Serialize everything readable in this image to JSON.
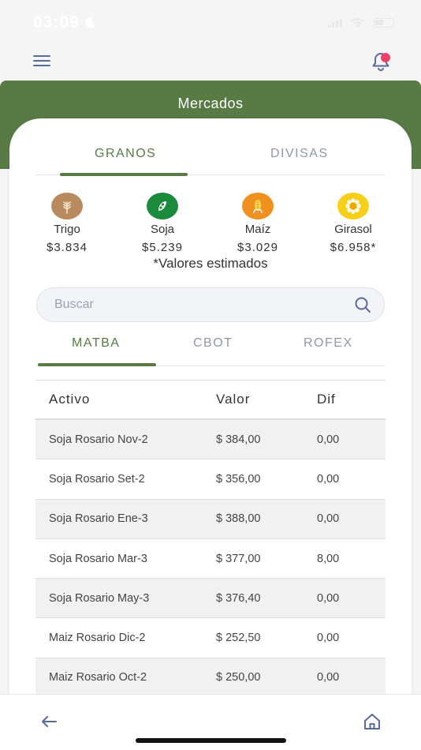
{
  "status_bar": {
    "time": "03:09"
  },
  "header": {
    "title": "Mercados"
  },
  "main_tabs": [
    {
      "label": "GRANOS",
      "active": true
    },
    {
      "label": "DIVISAS",
      "active": false
    }
  ],
  "grains": [
    {
      "name": "Trigo",
      "price": "$3.834",
      "icon": "wheat-icon",
      "color": "#b88a5e"
    },
    {
      "name": "Soja",
      "price": "$5.239",
      "icon": "soy-icon",
      "color": "#1a8a3c"
    },
    {
      "name": "Maíz",
      "price": "$3.029",
      "icon": "corn-icon",
      "color": "#f0901e"
    },
    {
      "name": "Girasol",
      "price": "$6.958*",
      "icon": "sunflower-icon",
      "color": "#f6cf18"
    }
  ],
  "estimated_note": "*Valores estimados",
  "search": {
    "placeholder": "Buscar"
  },
  "sub_tabs": [
    {
      "label": "MATBA",
      "active": true
    },
    {
      "label": "CBOT",
      "active": false
    },
    {
      "label": "ROFEX",
      "active": false
    }
  ],
  "table": {
    "headers": {
      "activo": "Activo",
      "valor": "Valor",
      "dif": "Dif"
    },
    "rows": [
      {
        "activo": "Soja Rosario Nov-2",
        "valor": "$ 384,00",
        "dif": "0,00"
      },
      {
        "activo": "Soja Rosario Set-2",
        "valor": "$ 356,00",
        "dif": "0,00"
      },
      {
        "activo": "Soja Rosario Ene-3",
        "valor": "$ 388,00",
        "dif": "0,00"
      },
      {
        "activo": "Soja Rosario Mar-3",
        "valor": "$ 377,00",
        "dif": "8,00"
      },
      {
        "activo": "Soja Rosario May-3",
        "valor": "$ 376,40",
        "dif": "0,00"
      },
      {
        "activo": "Maiz Rosario Dic-2",
        "valor": "$ 252,50",
        "dif": "0,00"
      },
      {
        "activo": "Maiz Rosario Oct-2",
        "valor": "$ 250,00",
        "dif": "0,00"
      }
    ]
  },
  "colors": {
    "brand_green": "#587a45",
    "notification": "#f0406a",
    "nav_icon": "#5a6a9a"
  }
}
